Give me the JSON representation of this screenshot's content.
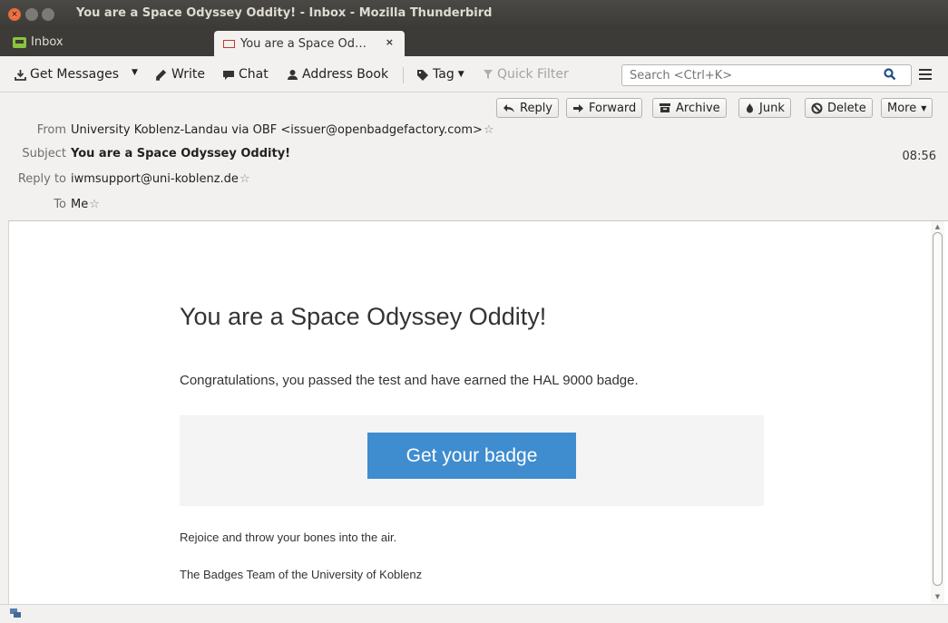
{
  "window": {
    "title": "You are a Space Odyssey Oddity! - Inbox - Mozilla Thunderbird"
  },
  "tabs": {
    "inbox": "Inbox",
    "active": "You are a Space Od…",
    "close_glyph": "×"
  },
  "toolbar": {
    "get_messages": "Get Messages",
    "write": "Write",
    "chat": "Chat",
    "address_book": "Address Book",
    "tag": "Tag",
    "quick_filter": "Quick Filter",
    "search_placeholder": "Search <Ctrl+K>"
  },
  "actions": {
    "reply": "Reply",
    "forward": "Forward",
    "archive": "Archive",
    "junk": "Junk",
    "delete": "Delete",
    "more": "More"
  },
  "header": {
    "from_label": "From",
    "from_value": "University Koblenz-Landau via OBF <issuer@openbadgefactory.com>",
    "subject_label": "Subject",
    "subject_value": "You are a Space Odyssey Oddity!",
    "time": "08:56",
    "replyto_label": "Reply to",
    "replyto_value": "iwmsupport@uni-koblenz.de",
    "to_label": "To",
    "to_value": "Me"
  },
  "message": {
    "title": "You are a Space Odyssey Oddity!",
    "congrats": "Congratulations, you passed the test and have earned the HAL 9000 badge.",
    "button": "Get your badge",
    "rejoice": "Rejoice and throw your bones into the air.",
    "signature": "The Badges Team of the University of Koblenz"
  },
  "colors": {
    "accent_button": "#3f8ccf",
    "titlebar": "#3c3b37"
  }
}
